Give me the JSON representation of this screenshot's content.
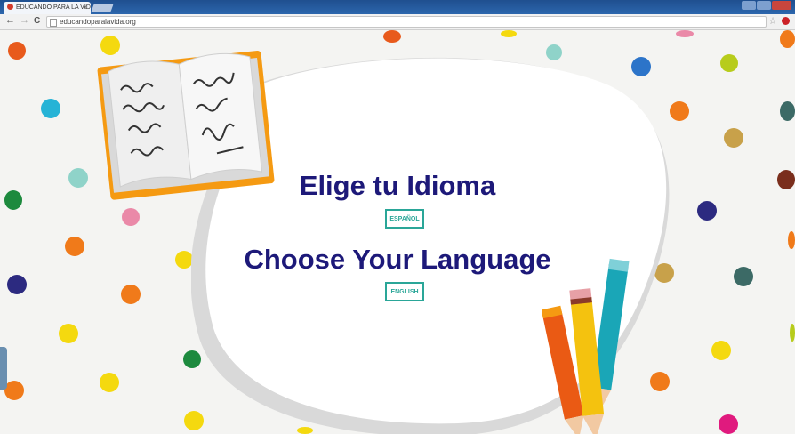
{
  "browser": {
    "tab_title": "EDUCANDO PARA LA VID",
    "tab_close": "×",
    "url": "educandoparalavida.org",
    "back": "←",
    "forward": "→",
    "reload": "C",
    "star": "☆"
  },
  "page": {
    "heading_es": "Elige tu Idioma",
    "button_es": "ESPAÑOL",
    "heading_en": "Choose Your Language",
    "button_en": "ENGLISH"
  },
  "colors": {
    "heading": "#1d1979",
    "button_accent": "#2aa698",
    "book_cover": "#f59a12",
    "background": "#f4f4f2"
  },
  "icons": [
    "favicon-icon",
    "back-arrow-icon",
    "forward-arrow-icon",
    "reload-icon",
    "page-icon",
    "star-icon",
    "pinterest-icon",
    "open-book-illustration",
    "colored-pencils-illustration",
    "polka-dot-pattern"
  ]
}
